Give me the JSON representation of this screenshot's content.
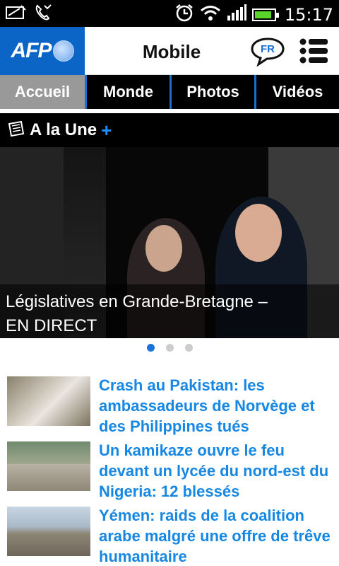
{
  "status_bar": {
    "time": "15:17",
    "icons": [
      "notification-icon",
      "missed-call-icon",
      "alarm-icon",
      "wifi-icon",
      "signal-icon",
      "battery-icon"
    ],
    "battery_level": 0.9
  },
  "header": {
    "logo_text": "AFP",
    "title": "Mobile",
    "language": "FR",
    "accent_color": "#0a65c6"
  },
  "tabs": [
    {
      "label": "Accueil",
      "active": true
    },
    {
      "label": "Monde",
      "active": false
    },
    {
      "label": "Photos",
      "active": false
    },
    {
      "label": "Vidéos",
      "active": false
    }
  ],
  "section": {
    "title": "A la Une",
    "plus": "+"
  },
  "hero": {
    "caption_line1": "Législatives en Grande-Bretagne –",
    "caption_line2": "EN DIRECT"
  },
  "pager": {
    "count": 3,
    "active_index": 0
  },
  "news": [
    {
      "title": "Crash au Pakistan: les ambassadeurs de Norvège et des Philippines tués"
    },
    {
      "title": "Un kamikaze ouvre le feu devant un lycée du nord-est du Nigeria: 12 blessés"
    },
    {
      "title": "Yémen: raids de la coalition arabe malgré une offre de trêve humanitaire"
    }
  ],
  "colors": {
    "link_blue": "#1687e3",
    "tab_divider": "#1a6fd1",
    "active_tab": "#999999"
  }
}
